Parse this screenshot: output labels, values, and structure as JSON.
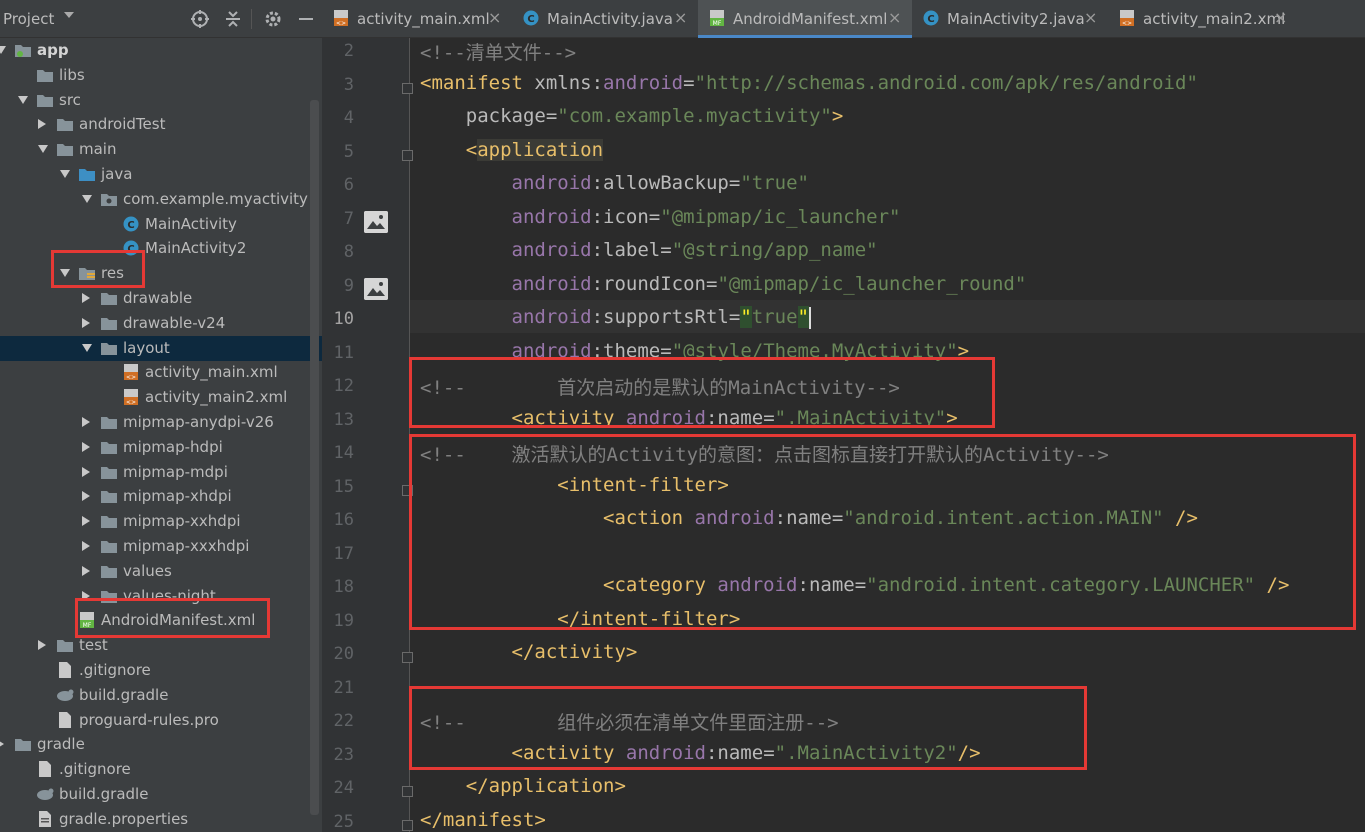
{
  "project_panel": {
    "title": "Project",
    "tree": [
      {
        "label": "app",
        "bold": true
      },
      {
        "label": "libs"
      },
      {
        "label": "src"
      },
      {
        "label": "androidTest"
      },
      {
        "label": "main"
      },
      {
        "label": "java"
      },
      {
        "label": "com.example.myactivity"
      },
      {
        "label": "MainActivity"
      },
      {
        "label": "MainActivity2"
      },
      {
        "label": "res"
      },
      {
        "label": "drawable"
      },
      {
        "label": "drawable-v24"
      },
      {
        "label": "layout"
      },
      {
        "label": "activity_main.xml"
      },
      {
        "label": "activity_main2.xml"
      },
      {
        "label": "mipmap-anydpi-v26"
      },
      {
        "label": "mipmap-hdpi"
      },
      {
        "label": "mipmap-mdpi"
      },
      {
        "label": "mipmap-xhdpi"
      },
      {
        "label": "mipmap-xxhdpi"
      },
      {
        "label": "mipmap-xxxhdpi"
      },
      {
        "label": "values"
      },
      {
        "label": "values-night"
      },
      {
        "label": "AndroidManifest.xml"
      },
      {
        "label": "test"
      },
      {
        "label": ".gitignore"
      },
      {
        "label": "build.gradle"
      },
      {
        "label": "proguard-rules.pro"
      },
      {
        "label": "gradle"
      },
      {
        "label": ".gitignore"
      },
      {
        "label": "build.gradle"
      },
      {
        "label": "gradle.properties"
      }
    ]
  },
  "tabs": [
    {
      "label": "activity_main.xml",
      "icon": "xml-layout-icon"
    },
    {
      "label": "MainActivity.java",
      "icon": "java-class-icon"
    },
    {
      "label": "AndroidManifest.xml",
      "icon": "manifest-icon",
      "active": true
    },
    {
      "label": "MainActivity2.java",
      "icon": "java-class-icon"
    },
    {
      "label": "activity_main2.xml",
      "icon": "xml-layout-icon"
    }
  ],
  "tab_close_glyph": "×",
  "editor": {
    "current_line": "10",
    "line_numbers": [
      "2",
      "3",
      "4",
      "5",
      "6",
      "7",
      "8",
      "9",
      "10",
      "11",
      "12",
      "13",
      "14",
      "15",
      "16",
      "17",
      "18",
      "19",
      "20",
      "21",
      "22",
      "23",
      "24",
      "25"
    ],
    "lines": [
      {
        "t": [
          [
            "c-com",
            "<!--清单文件-->"
          ]
        ]
      },
      {
        "t": [
          [
            "c-tag",
            "<manifest "
          ],
          [
            "c-attr",
            "xmlns:"
          ],
          [
            "c-ns",
            "android"
          ],
          [
            "c-attr",
            "="
          ],
          [
            "c-str",
            "\"http://schemas.android.com/apk/res/android\""
          ]
        ]
      },
      {
        "t": [
          [
            "c-attr",
            "    package"
          ],
          [
            "c-attr",
            "="
          ],
          [
            "c-str",
            "\"com.example.myactivity\""
          ],
          [
            "c-tag",
            ">"
          ]
        ]
      },
      {
        "t": [
          [
            "c-tag",
            "    <"
          ],
          [
            "c-tag hl",
            "application"
          ]
        ]
      },
      {
        "t": [
          [
            "c-ns",
            "        android"
          ],
          [
            "c-attr",
            ":allowBackup"
          ],
          [
            "c-attr",
            "="
          ],
          [
            "c-str",
            "\"true\""
          ]
        ]
      },
      {
        "t": [
          [
            "c-ns",
            "        android"
          ],
          [
            "c-attr",
            ":icon"
          ],
          [
            "c-attr",
            "="
          ],
          [
            "c-str",
            "\"@mipmap/ic_launcher\""
          ]
        ]
      },
      {
        "t": [
          [
            "c-ns",
            "        android"
          ],
          [
            "c-attr",
            ":label"
          ],
          [
            "c-attr",
            "="
          ],
          [
            "c-str",
            "\"@string/app_name\""
          ]
        ]
      },
      {
        "t": [
          [
            "c-ns",
            "        android"
          ],
          [
            "c-attr",
            ":roundIcon"
          ],
          [
            "c-attr",
            "="
          ],
          [
            "c-str",
            "\"@mipmap/ic_launcher_round\""
          ]
        ]
      },
      {
        "t": [
          [
            "c-ns",
            "        android"
          ],
          [
            "c-attr",
            ":supportsRtl"
          ],
          [
            "c-attr",
            "="
          ],
          [
            "c-str quote-hl",
            "\""
          ],
          [
            "c-str",
            "true"
          ],
          [
            "c-str quote-hl",
            "\""
          ]
        ],
        "caret": true
      },
      {
        "t": [
          [
            "c-ns",
            "        android"
          ],
          [
            "c-attr",
            ":theme"
          ],
          [
            "c-attr",
            "="
          ],
          [
            "c-str",
            "\"@style/Theme.MyActivity\""
          ],
          [
            "c-tag",
            ">"
          ]
        ]
      },
      {
        "t": [
          [
            "c-com",
            "<!--        首次启动的是默认的MainActivity-->"
          ]
        ]
      },
      {
        "t": [
          [
            "c-tag",
            "        <activity "
          ],
          [
            "c-ns",
            "android"
          ],
          [
            "c-attr",
            ":name"
          ],
          [
            "c-attr",
            "="
          ],
          [
            "c-str",
            "\".MainActivity\""
          ],
          [
            "c-tag",
            ">"
          ]
        ]
      },
      {
        "t": [
          [
            "c-com",
            "<!--    激活默认的Activity的意图：点击图标直接打开默认的Activity-->"
          ]
        ]
      },
      {
        "t": [
          [
            "c-tag",
            "            <intent-filter>"
          ]
        ]
      },
      {
        "t": [
          [
            "c-tag",
            "                <action "
          ],
          [
            "c-ns",
            "android"
          ],
          [
            "c-attr",
            ":name"
          ],
          [
            "c-attr",
            "="
          ],
          [
            "c-str",
            "\"android.intent.action.MAIN\""
          ],
          [
            "c-tag",
            " />"
          ]
        ]
      },
      {
        "t": [
          [
            "c-txt",
            ""
          ]
        ]
      },
      {
        "t": [
          [
            "c-tag",
            "                <category "
          ],
          [
            "c-ns",
            "android"
          ],
          [
            "c-attr",
            ":name"
          ],
          [
            "c-attr",
            "="
          ],
          [
            "c-str",
            "\"android.intent.category.LAUNCHER\""
          ],
          [
            "c-tag",
            " />"
          ]
        ]
      },
      {
        "t": [
          [
            "c-tag",
            "            </intent-filter>"
          ]
        ]
      },
      {
        "t": [
          [
            "c-tag",
            "        </activity>"
          ]
        ]
      },
      {
        "t": [
          [
            "c-txt",
            ""
          ]
        ]
      },
      {
        "t": [
          [
            "c-com",
            "<!--        组件必须在清单文件里面注册-->"
          ]
        ]
      },
      {
        "t": [
          [
            "c-tag",
            "        <activity "
          ],
          [
            "c-ns",
            "android"
          ],
          [
            "c-attr",
            ":name"
          ],
          [
            "c-attr",
            "="
          ],
          [
            "c-str",
            "\".MainActivity2\""
          ],
          [
            "c-tag",
            "/>"
          ]
        ]
      },
      {
        "t": [
          [
            "c-tag",
            "    </application>"
          ]
        ]
      },
      {
        "t": [
          [
            "c-tag",
            "</manifest>"
          ]
        ]
      }
    ]
  }
}
